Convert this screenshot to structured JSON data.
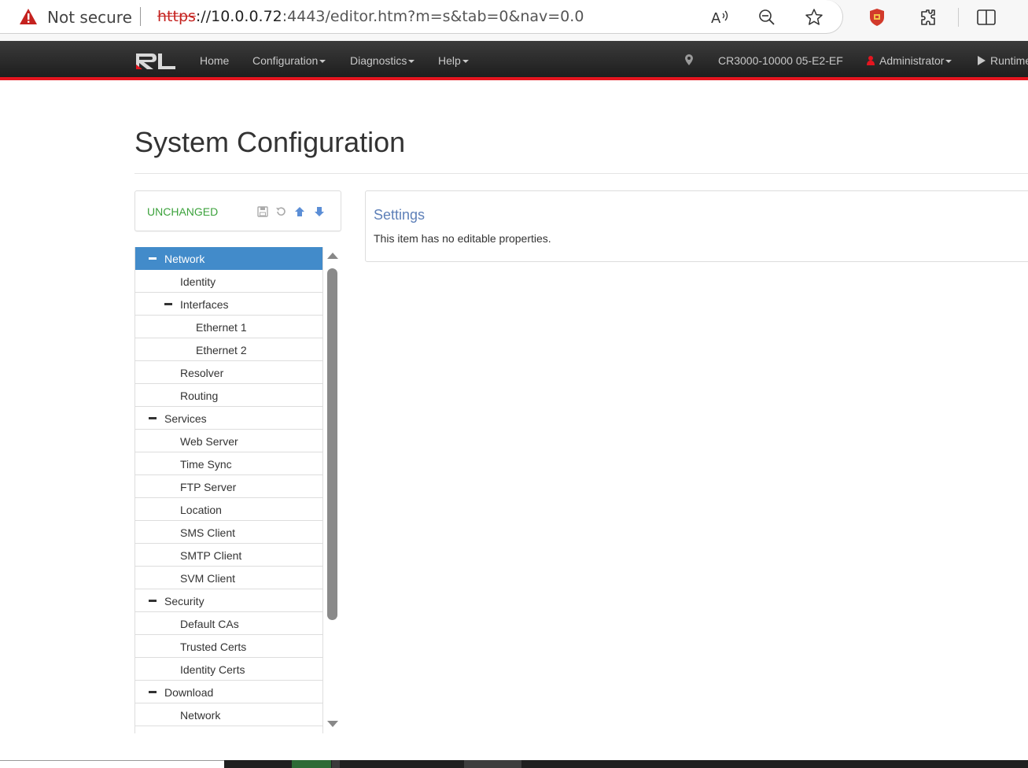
{
  "browser": {
    "security_label": "Not secure",
    "url_protocol": "https",
    "url_rest_host": "://10.0.0.72",
    "url_path": ":4443/editor.htm?m=s&tab=0&nav=0.0"
  },
  "navbar": {
    "logo_text": "RL",
    "home": "Home",
    "configuration": "Configuration",
    "diagnostics": "Diagnostics",
    "help": "Help",
    "device": "CR3000-10000 05-E2-EF",
    "user": "Administrator",
    "runtime": "Runtime",
    "accent_color": "#e5151f"
  },
  "page": {
    "title": "System Configuration"
  },
  "toolbar": {
    "status": "UNCHANGED",
    "status_color": "#3ca23c"
  },
  "tree": {
    "items": [
      {
        "label": "Network",
        "level": 0,
        "expanded": true,
        "selected": true
      },
      {
        "label": "Identity",
        "level": 1
      },
      {
        "label": "Interfaces",
        "level": 1,
        "expanded": true
      },
      {
        "label": "Ethernet 1",
        "level": 2
      },
      {
        "label": "Ethernet 2",
        "level": 2
      },
      {
        "label": "Resolver",
        "level": 1
      },
      {
        "label": "Routing",
        "level": 1
      },
      {
        "label": "Services",
        "level": 0,
        "expanded": true
      },
      {
        "label": "Web Server",
        "level": 1
      },
      {
        "label": "Time Sync",
        "level": 1
      },
      {
        "label": "FTP Server",
        "level": 1
      },
      {
        "label": "Location",
        "level": 1
      },
      {
        "label": "SMS Client",
        "level": 1
      },
      {
        "label": "SMTP Client",
        "level": 1
      },
      {
        "label": "SVM Client",
        "level": 1
      },
      {
        "label": "Security",
        "level": 0,
        "expanded": true
      },
      {
        "label": "Default CAs",
        "level": 1
      },
      {
        "label": "Trusted Certs",
        "level": 1
      },
      {
        "label": "Identity Certs",
        "level": 1
      },
      {
        "label": "Download",
        "level": 0,
        "expanded": true
      },
      {
        "label": "Network",
        "level": 1
      }
    ]
  },
  "settings": {
    "title": "Settings",
    "message": "This item has no editable properties."
  }
}
